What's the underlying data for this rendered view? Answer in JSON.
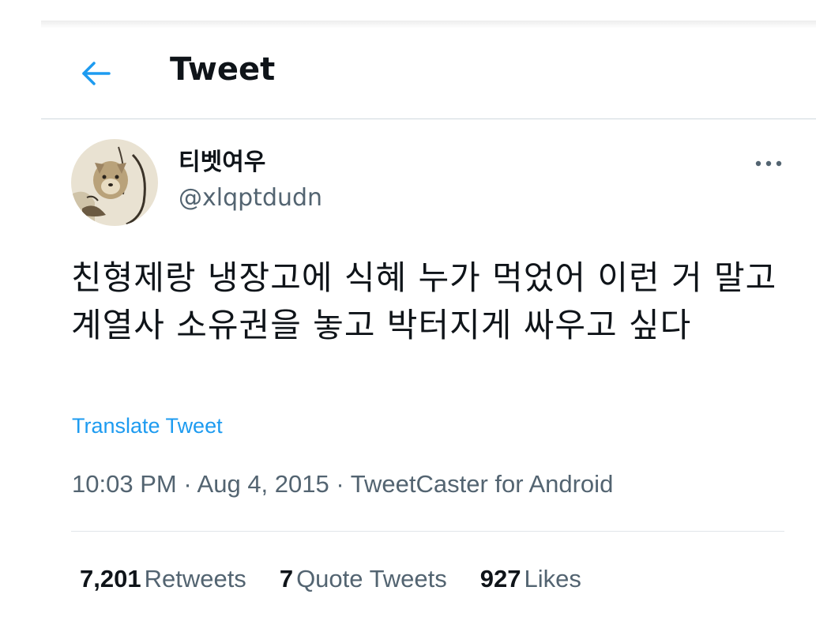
{
  "header": {
    "back_icon": "arrow-left-icon",
    "title": "Tweet"
  },
  "tweet": {
    "author": {
      "display_name": "티벳여우",
      "handle": "@xlqptdudn",
      "avatar_icon": "fox-avatar"
    },
    "more_icon": "more-dots-icon",
    "text": "친형제랑 냉장고에 식혜 누가 먹었어 이런 거 말고 계열사 소유권을 놓고 박터지게 싸우고 싶다",
    "translate_label": "Translate Tweet",
    "meta": {
      "time": "10:03 PM",
      "separator": " · ",
      "date": "Aug 4, 2015",
      "source": "TweetCaster for Android"
    },
    "stats": {
      "retweets": {
        "count": "7,201",
        "label": "Retweets"
      },
      "quote_tweets": {
        "count": "7",
        "label": "Quote Tweets"
      },
      "likes": {
        "count": "927",
        "label": "Likes"
      }
    }
  },
  "colors": {
    "accent": "#1d9bf0",
    "text_primary": "#0f1419",
    "text_secondary": "#536471",
    "divider": "#cfd9de"
  }
}
